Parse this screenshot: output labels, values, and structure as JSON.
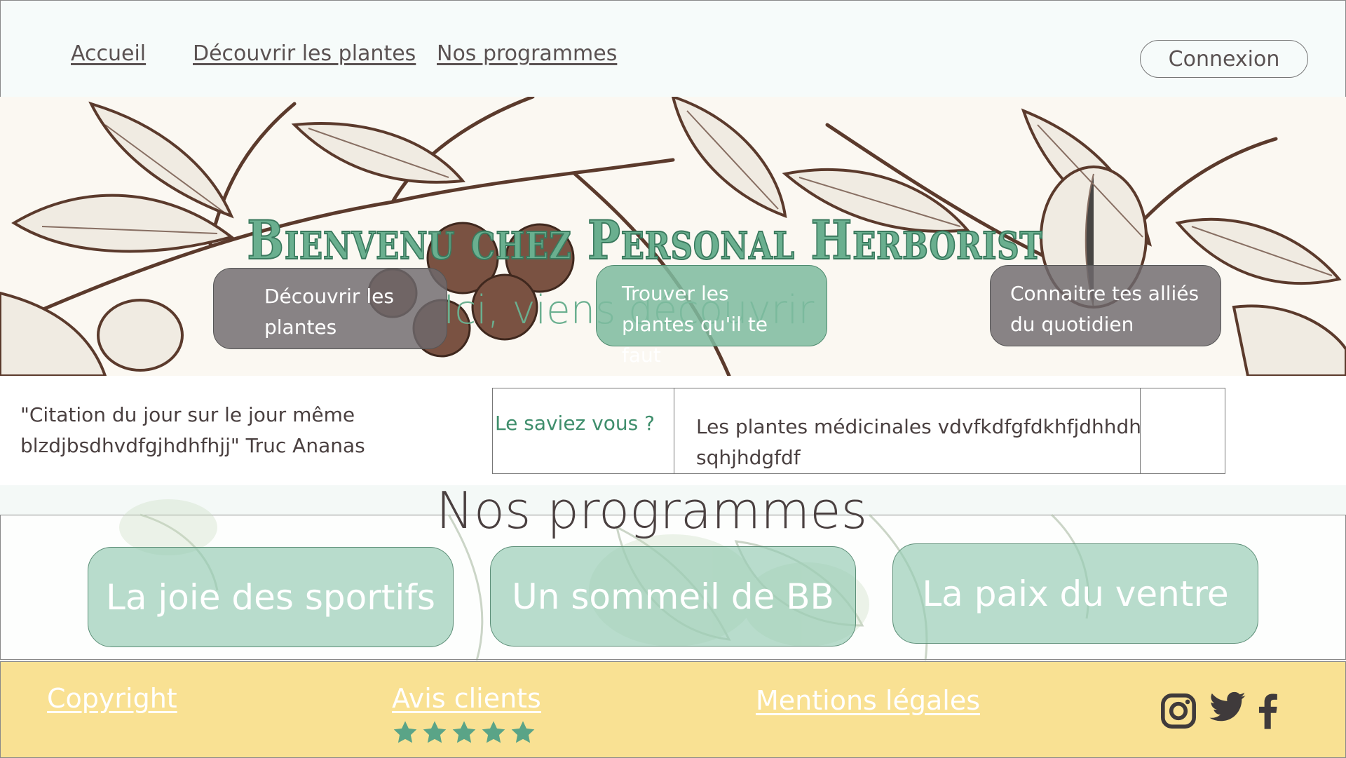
{
  "header": {
    "nav": [
      "Accueil",
      "Découvrir les plantes",
      "Nos programmes"
    ],
    "login_label": "Connexion"
  },
  "hero": {
    "title": "Bienvenu chez Personal Herborist",
    "subtitle": "Ici, viens découvrir",
    "buttons": [
      {
        "label": "Découvrir les plantes"
      },
      {
        "label": "Trouver les plantes qu'il te faut"
      },
      {
        "label": "Connaitre tes alliés du quotidien"
      }
    ]
  },
  "info": {
    "quote": "\"Citation du jour sur le jour même blzdjbsdhvdfgjhdhfhjj\" Truc Ananas",
    "fact_title": "Le saviez vous ?",
    "fact_text": "Les plantes médicinales vdvfkdfgfdkhfjdhhdh sqhjhdgfdf"
  },
  "programmes": {
    "title": "Nos programmes",
    "cards": [
      "La joie des sportifs",
      "Un sommeil de BB",
      "La paix du ventre"
    ]
  },
  "footer": {
    "copyright": "Copyright",
    "reviews": "Avis clients",
    "rating": 5,
    "legal": "Mentions légales",
    "social": [
      "instagram-icon",
      "twitter-icon",
      "facebook-icon"
    ]
  },
  "colors": {
    "accent_green": "#6aaf8f",
    "footer_yellow": "#f9e193",
    "text_dark": "#4a4040"
  }
}
